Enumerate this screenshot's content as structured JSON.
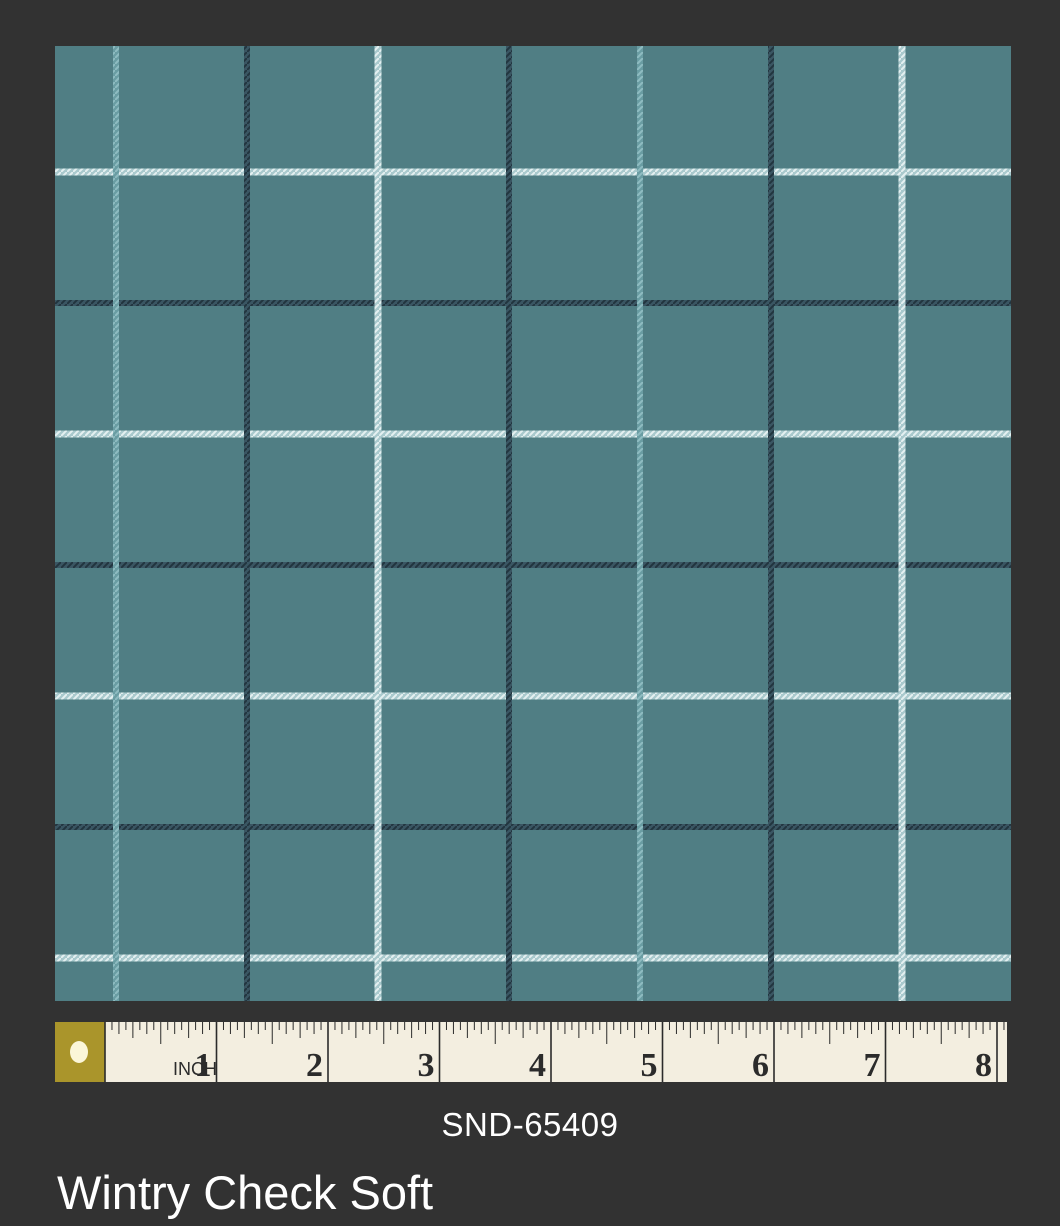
{
  "fabric": {
    "sku": "SND-65409",
    "name": "Wintry Check Soft",
    "colors": {
      "ground": "#507e84",
      "light_stripe": "#c6dcdf",
      "dark_stripe": "#2c4451",
      "mid_stripe": "#79aab0",
      "background": "#323232"
    }
  },
  "ruler": {
    "unit_label": "INCH",
    "numbers": [
      "1",
      "2",
      "3",
      "4",
      "5",
      "6",
      "7",
      "8"
    ],
    "colors": {
      "tape": "#f3eee0",
      "tick": "#2b2b2b",
      "clip": "#b8a433"
    }
  }
}
